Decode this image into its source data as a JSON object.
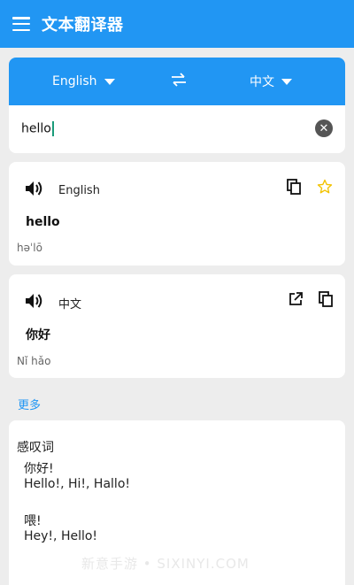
{
  "app": {
    "title": "文本翻译器"
  },
  "lang_bar": {
    "source": "English",
    "target": "中文"
  },
  "input": {
    "value": "hello"
  },
  "result_source": {
    "lang": "English",
    "word": "hello",
    "phonetic": "həˈlō"
  },
  "result_target": {
    "lang": "中文",
    "word": "你好",
    "phonetic": "Nǐ hǎo"
  },
  "more_label": "更多",
  "dictionary": {
    "pos": "感叹词",
    "entries": [
      {
        "word": "你好!",
        "translations": "Hello!, Hi!, Hallo!"
      },
      {
        "word": "喂!",
        "translations": "Hey!, Hello!"
      }
    ]
  },
  "watermark": "新意手游 • SIXINYI.COM",
  "colors": {
    "primary": "#2196f3",
    "background": "#ededed",
    "star": "#f2c200"
  }
}
